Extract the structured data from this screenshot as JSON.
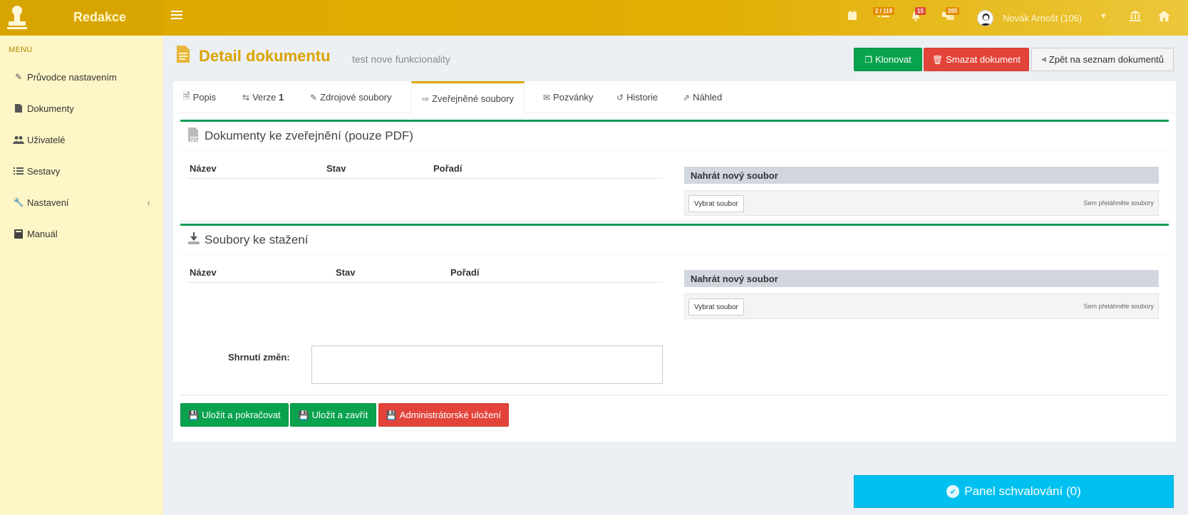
{
  "app": {
    "brand": "Redakce"
  },
  "topbar": {
    "badges": {
      "tasks": "2 / 119",
      "notifications": "15",
      "messages": "265"
    },
    "user": "Novák Arnošt (106)",
    "colors": {
      "tasks": "#e38c00",
      "notifications": "#dd4b39",
      "messages": "#e38c00"
    }
  },
  "sidebar": {
    "menu_label": "MENU",
    "items": [
      {
        "label": "Průvodce nastavením",
        "icon": "pencil-icon"
      },
      {
        "label": "Dokumenty",
        "icon": "document-icon"
      },
      {
        "label": "Uživatelé",
        "icon": "users-icon"
      },
      {
        "label": "Sestavy",
        "icon": "list-icon"
      },
      {
        "label": "Nastavení",
        "icon": "wrench-icon"
      },
      {
        "label": "Manuál",
        "icon": "book-icon"
      }
    ]
  },
  "header": {
    "title": "Detail dokumentu",
    "subtitle": "test nove funkcionality",
    "clone_label": "Klonovat",
    "delete_label": "Smazat dokument",
    "back_label": "Zpět na seznam dokumentů"
  },
  "tabs": [
    {
      "label": "Popis"
    },
    {
      "label": "Verze",
      "count": "1"
    },
    {
      "label": "Zdrojové soubory"
    },
    {
      "label": "Zveřejněné soubory"
    },
    {
      "label": "Pozvánky"
    },
    {
      "label": "Historie"
    },
    {
      "label": "Náhled"
    }
  ],
  "published_box": {
    "title": "Dokumenty ke zveřejnění (pouze PDF)",
    "columns": [
      "Název",
      "Stav",
      "Pořadí"
    ],
    "upload_title": "Nahrát nový soubor",
    "upload_button": "Vybrat soubor",
    "drop_hint": "Sem přetáhněte soubory"
  },
  "download_box": {
    "title": "Soubory ke stažení",
    "columns": [
      "Název",
      "Stav",
      "Pořadí"
    ],
    "upload_title": "Nahrát nový soubor",
    "upload_button": "Vybrat soubor",
    "drop_hint": "Sem přetáhněte soubory"
  },
  "summary": {
    "label": "Shrnutí změn:",
    "value": ""
  },
  "actions": {
    "save_continue": "Uložit a pokračovat",
    "save_close": "Uložit a zavřít",
    "admin_save": "Administrátorské uložení"
  },
  "approval_panel": {
    "label": "Panel schvalování",
    "count": "(0)"
  }
}
